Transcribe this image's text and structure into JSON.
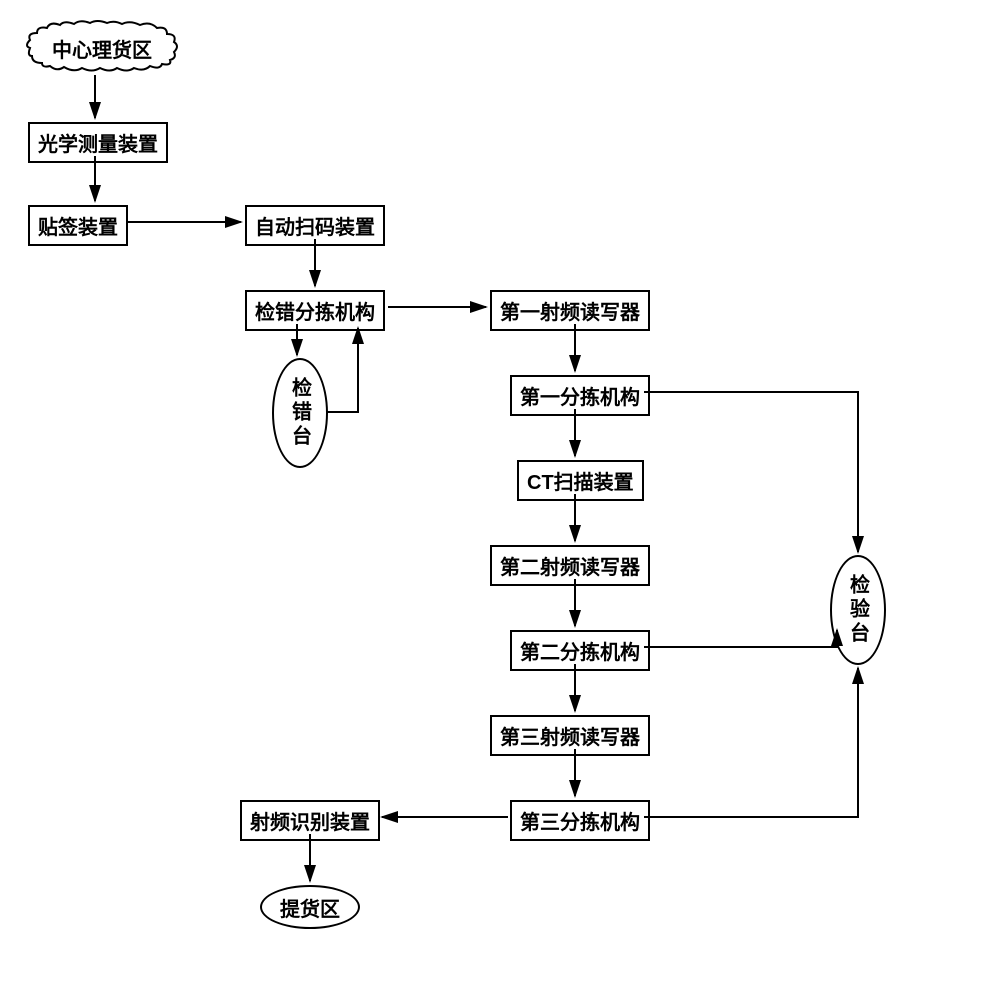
{
  "nodes": {
    "cloud": "中心理货区",
    "optical": "光学测量装置",
    "label_device": "贴签装置",
    "auto_scan": "自动扫码装置",
    "error_sort": "检错分拣机构",
    "error_stn": "检错台",
    "rf1": "第一射频读写器",
    "sort1": "第一分拣机构",
    "ct": "CT扫描装置",
    "rf2": "第二射频读写器",
    "sort2": "第二分拣机构",
    "rf3": "第三射频读写器",
    "sort3": "第三分拣机构",
    "rfid": "射频识别装置",
    "pickup": "提货区",
    "inspect": "检验台"
  }
}
